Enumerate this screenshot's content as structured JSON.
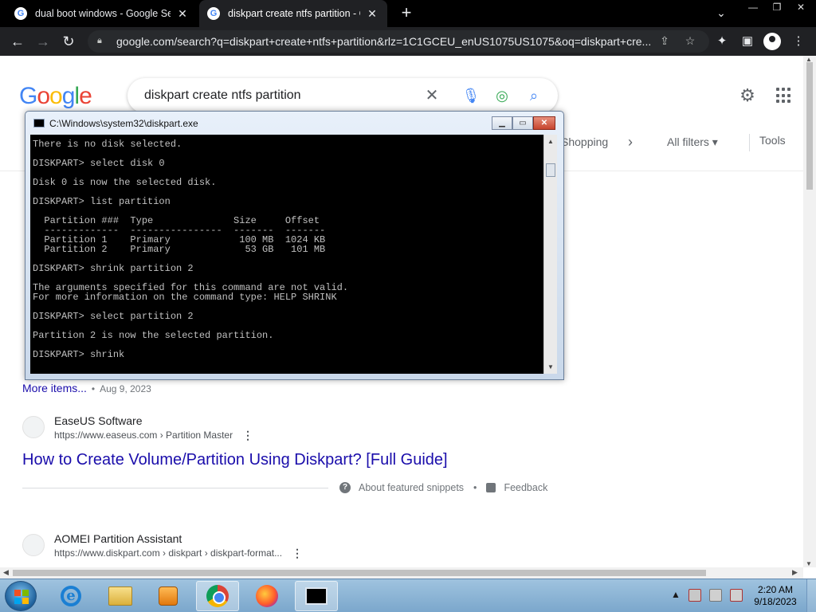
{
  "browser": {
    "tabs": [
      {
        "title": "dual boot windows - Google Sea",
        "active": false
      },
      {
        "title": "diskpart create ntfs partition - Go",
        "active": true
      }
    ],
    "url": "google.com/search?q=diskpart+create+ntfs+partition&rlz=1C1GCEU_enUS1075US1075&oq=diskpart+cre..."
  },
  "search": {
    "logo": "Google",
    "query": "diskpart create ntfs partition",
    "chips": {
      "shopping": "Shopping",
      "all_filters": "All filters",
      "tools": "Tools"
    }
  },
  "results": {
    "more_items": "More items...",
    "more_items_date": "Aug 9, 2023",
    "easeus": {
      "site_name": "EaseUS Software",
      "site_url": "https://www.easeus.com › Partition Master",
      "title": "How to Create Volume/Partition Using Diskpart? [Full Guide]"
    },
    "featured": {
      "about": "About featured snippets",
      "feedback": "Feedback"
    },
    "aomei": {
      "site_name": "AOMEI Partition Assistant",
      "site_url": "https://www.diskpart.com › diskpart › diskpart-format..."
    }
  },
  "console": {
    "title": "C:\\Windows\\system32\\diskpart.exe",
    "text": "There is no disk selected.\n\nDISKPART> select disk 0\n\nDisk 0 is now the selected disk.\n\nDISKPART> list partition\n\n  Partition ###  Type              Size     Offset\n  -------------  ----------------  -------  -------\n  Partition 1    Primary            100 MB  1024 KB\n  Partition 2    Primary             53 GB   101 MB\n\nDISKPART> shrink partition 2\n\nThe arguments specified for this command are not valid.\nFor more information on the command type: HELP SHRINK\n\nDISKPART> select partition 2\n\nPartition 2 is now the selected partition.\n\nDISKPART> shrink"
  },
  "taskbar": {
    "time": "2:20 AM",
    "date": "9/18/2023"
  }
}
